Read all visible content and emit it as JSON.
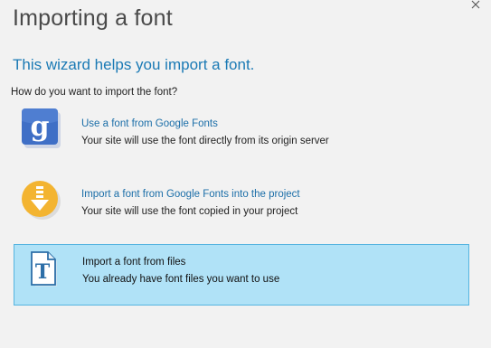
{
  "dialog": {
    "title": "Importing a font",
    "subtitle": "This wizard helps you import a font.",
    "question": "How do you want to import the font?"
  },
  "options": [
    {
      "title": "Use a font from Google Fonts",
      "desc": "Your site will use the font directly from its origin server",
      "icon": "google-icon"
    },
    {
      "title": "Import a font from Google Fonts into the project",
      "desc": "Your site will use the font copied in your project",
      "icon": "download-icon"
    },
    {
      "title": "Import a font from files",
      "desc": "You already have font files you want to use",
      "icon": "font-file-icon",
      "selected": true
    }
  ],
  "colors": {
    "accent": "#1b7ab5",
    "selected_bg": "#b0e2f7",
    "selected_border": "#55b4e0"
  }
}
